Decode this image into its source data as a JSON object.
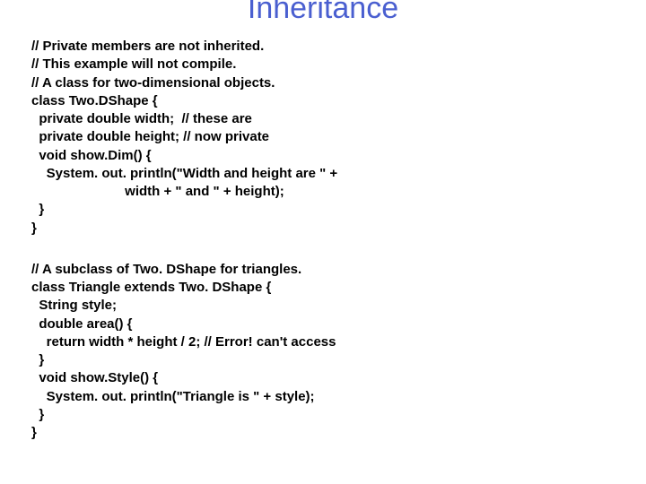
{
  "title": "Inheritance",
  "code1": "// Private members are not inherited.\n// This example will not compile.\n// A class for two-dimensional objects.\nclass Two.DShape {\n  private double width;  // these are\n  private double height; // now private\n  void show.Dim() {\n    System. out. println(\"Width and height are \" +\n                         width + \" and \" + height);\n  }\n}",
  "code2": "// A subclass of Two. DShape for triangles.\nclass Triangle extends Two. DShape {\n  String style;\n  double area() {\n    return width * height / 2; // Error! can't access\n  }\n  void show.Style() {\n    System. out. println(\"Triangle is \" + style);\n  }\n}"
}
